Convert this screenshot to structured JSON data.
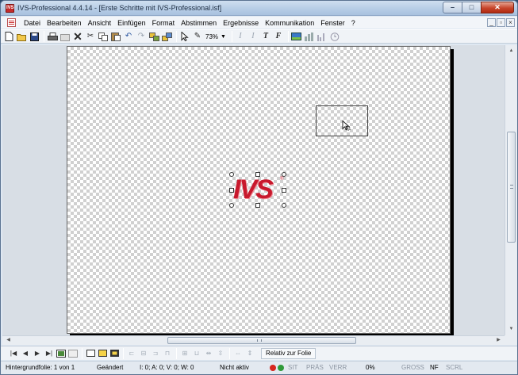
{
  "window": {
    "title": "IVS-Professional 4.4.14 - [Erste Schritte mit IVS-Professional.isf]",
    "app_icon_text": "IVS",
    "min_glyph": "–",
    "max_glyph": "□",
    "close_glyph": "✕"
  },
  "menu": {
    "items": [
      "Datei",
      "Bearbeiten",
      "Ansicht",
      "Einfügen",
      "Format",
      "Abstimmen",
      "Ergebnisse",
      "Kommunikation",
      "Fenster",
      "?"
    ],
    "mdi_min": "_",
    "mdi_restore": "▫",
    "mdi_close": "×"
  },
  "toolbar": {
    "zoom": "73%",
    "icons": [
      "new-doc",
      "open-folder",
      "save",
      "print",
      "preview",
      "delete",
      "cut",
      "copy",
      "paste",
      "undo",
      "redo",
      "group",
      "ungroup",
      "pointer",
      "pen",
      "italic",
      "italic-2",
      "text-bold",
      "text-italic",
      "slide-bg",
      "chart",
      "bar-chart",
      "timer"
    ]
  },
  "slide": {
    "logo_text": "IVS",
    "logo_registered": "®",
    "logo_color": "#c8192d"
  },
  "navbar": {
    "relativ_label": "Relativ zur Folie"
  },
  "status": {
    "background_slide": "Hintergrundfolie: 1 von 1",
    "changed": "Geändert",
    "counts": "I: 0;  A: 0;  V: 0;  W: 0",
    "active": "Nicht aktiv",
    "sit": "SIT",
    "pras": "PRÄS",
    "verr": "VERR",
    "percent": "0%",
    "gross": "GROSS",
    "nf": "NF",
    "scrl": "SCRL"
  }
}
